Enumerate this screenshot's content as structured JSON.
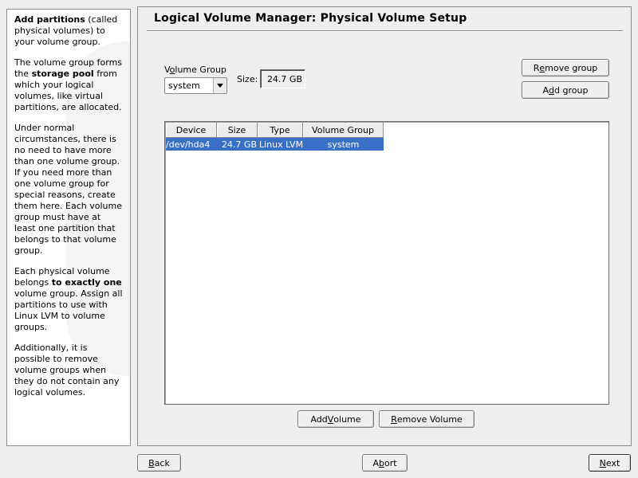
{
  "help": {
    "p1_bold": "Add partitions",
    "p1_rest": " (called physical volumes) to your volume group.",
    "p2_a": "The volume group forms the ",
    "p2_bold": "storage pool",
    "p2_b": " from which your logical volumes, like virtual partitions, are allocated.",
    "p3": "Under normal circumstances, there is no need to have more than one volume group. If you need more than one volume group for special reasons, create them here. Each volume group must have at least one partition that belongs to that volume group.",
    "p4_a": "Each physical volume belongs ",
    "p4_bold": "to exactly one",
    "p4_b": " volume group. Assign all partitions to use with Linux LVM to volume groups.",
    "p5": "Additionally, it is possible to remove volume groups when they do not contain any logical volumes."
  },
  "main": {
    "title": "Logical Volume Manager: Physical Volume Setup",
    "volume_group_label_pre": "V",
    "volume_group_label_u": "o",
    "volume_group_label_post": "lume Group",
    "volume_group_value": "system",
    "size_label": "Size:",
    "size_value": "24.7 GB",
    "remove_group_pre": "R",
    "remove_group_u": "e",
    "remove_group_post": "move group",
    "add_group_pre": "A",
    "add_group_u": "d",
    "add_group_post": "d group",
    "table": {
      "headers": [
        "Device",
        "Size",
        "Type",
        "Volume Group"
      ],
      "rows": [
        {
          "device": "/dev/hda4",
          "size": "24.7 GB",
          "type": "Linux LVM",
          "vg": "system"
        }
      ]
    },
    "add_volume_pre": "Add ",
    "add_volume_u": "V",
    "add_volume_post": "olume",
    "remove_volume_pre": "",
    "remove_volume_u": "R",
    "remove_volume_post": "emove Volume"
  },
  "nav": {
    "back_u": "B",
    "back_post": "ack",
    "abort_pre": "A",
    "abort_u": "b",
    "abort_post": "ort",
    "next_u": "N",
    "next_post": "ext"
  }
}
